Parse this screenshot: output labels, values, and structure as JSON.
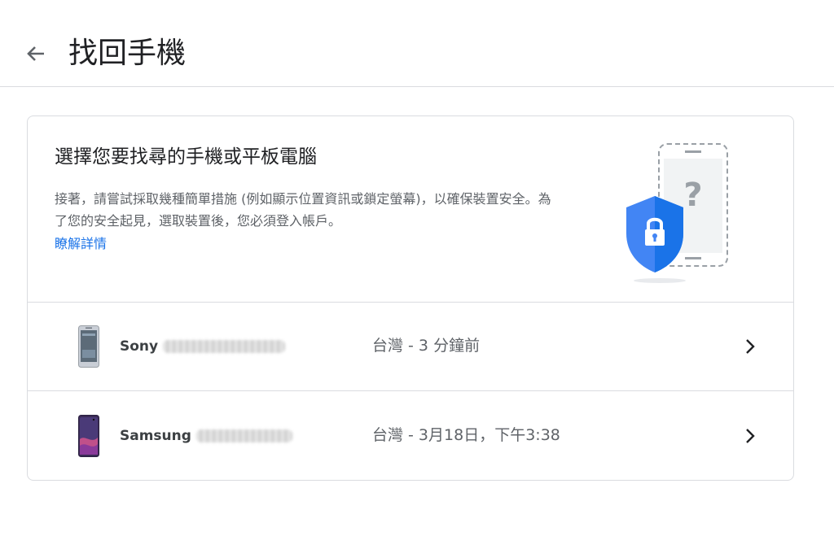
{
  "header": {
    "back_icon": "arrow-back-icon",
    "title": "找回手機"
  },
  "intro": {
    "title": "選擇您要找尋的手機或平板電腦",
    "description": "接著，請嘗試採取幾種簡單措施 (例如顯示位置資訊或鎖定螢幕)，以確保裝置安全。為了您的安全起見，選取裝置後，您必須登入帳戶。",
    "learn_more": "瞭解詳情",
    "illustration_icon": "phone-security-shield-icon"
  },
  "devices": [
    {
      "brand": "Sony",
      "model_redacted": true,
      "location_time": "台灣 - 3 分鐘前",
      "chevron_icon": "chevron-right-icon"
    },
    {
      "brand": "Samsung",
      "model_redacted": true,
      "location_time": "台灣 - 3月18日，下午3:38",
      "chevron_icon": "chevron-right-icon"
    }
  ],
  "colors": {
    "link": "#1a73e8",
    "shield": "#4285f4",
    "divider": "#dadce0",
    "secondary_text": "#5f6368"
  }
}
